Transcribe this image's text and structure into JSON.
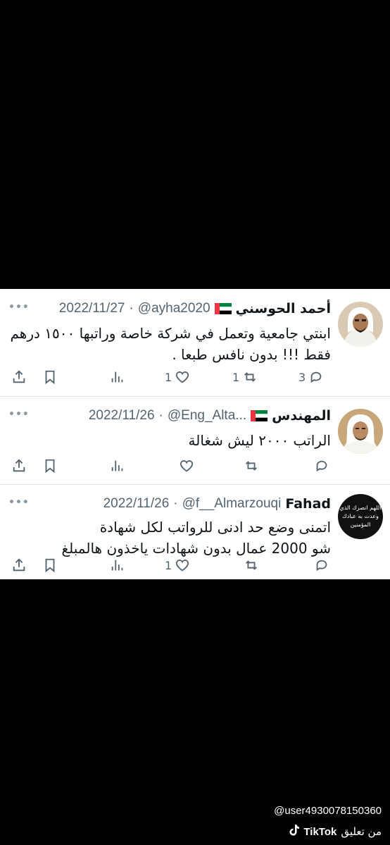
{
  "tweets": [
    {
      "name": "أحمد الحوسني",
      "handle": "@ayha2020",
      "date": "2022/11/27",
      "text_lines": [
        "ابنتي جامعية وتعمل في شركة خاصة وراتبها ١٥٠٠ درهم",
        "فقط !!! بدون نافس طبعا ."
      ],
      "stats": {
        "replies": "3",
        "retweets": "1",
        "likes": "1"
      },
      "avatar": "man-ghutra-avatar"
    },
    {
      "name": "المهندس",
      "handle": "@Eng_Alta...",
      "date": "2022/11/26",
      "text_lines": [
        "الراتب ٢٠٠٠ ليش شغالة"
      ],
      "stats": {
        "replies": "",
        "retweets": "",
        "likes": ""
      },
      "avatar": "man-portrait-avatar"
    },
    {
      "name": "Fahad",
      "handle": "@f__Almarzouqi",
      "date": "2022/11/26",
      "text_lines": [
        "اتمنى وضع حد ادنى للرواتب لكل شهادة",
        "شو 2000 عمال بدون شهادات ياخذون هالمبلغ"
      ],
      "stats": {
        "replies": "",
        "retweets": "",
        "likes": "1"
      },
      "avatar_text": [
        "اللهم انصرك الذي",
        "وعدت به عبادك",
        "المؤمنين"
      ]
    }
  ],
  "overlay": {
    "username": "@user4930078150360",
    "tiktok_label": "TikTok",
    "comment_from": "من تعليق"
  },
  "icons": [
    "share-icon",
    "bookmark-icon",
    "analytics-icon",
    "like-icon",
    "retweet-icon",
    "reply-icon",
    "more-icon",
    "uae-flag-icon",
    "tiktok-logo-icon"
  ],
  "colors": {
    "background": "#000000",
    "card": "#ffffff",
    "text": "#0f1419",
    "muted": "#536471"
  }
}
